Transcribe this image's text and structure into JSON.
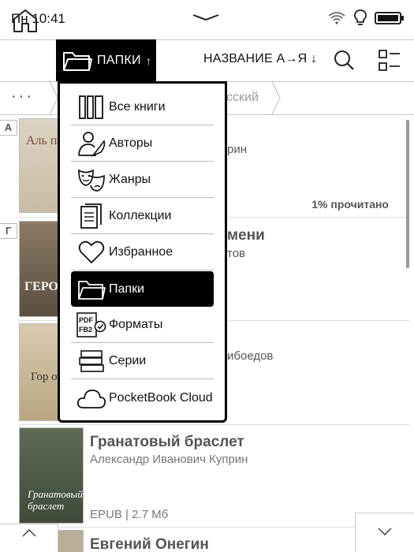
{
  "status_bar": {
    "time": "Пн 10:41"
  },
  "toolbar": {
    "folder_label": "ПАПКИ",
    "folder_arrow": "↑",
    "sort_label": "НАЗВАНИЕ А→Я ↓"
  },
  "breadcrumb": {
    "dots": "···",
    "current": "сский"
  },
  "letters": [
    "А",
    "Г"
  ],
  "books": [
    {
      "partial_title": "",
      "partial_author": "рин",
      "progress": "1% прочитано",
      "cover_text": "Аль пару"
    },
    {
      "partial_title": "мени",
      "partial_author": "тов",
      "cover_text": "ГЕРО"
    },
    {
      "partial_title": "",
      "partial_author": "ибоедов",
      "cover_text": "Гор от у"
    },
    {
      "title": "Гранатовый браслет",
      "author": "Александр Иванович Куприн",
      "meta": "EPUB | 2.7 Мб",
      "cover_text": "Гранатовый браслет"
    },
    {
      "title": "Евгений Онегин"
    }
  ],
  "menu": {
    "items": [
      {
        "label": "Все книги",
        "icon": "books-icon"
      },
      {
        "label": "Авторы",
        "icon": "author-icon"
      },
      {
        "label": "Жанры",
        "icon": "masks-icon"
      },
      {
        "label": "Коллекции",
        "icon": "collection-icon"
      },
      {
        "label": "Избранное",
        "icon": "heart-icon"
      },
      {
        "label": "Папки",
        "icon": "folder-icon",
        "active": true
      },
      {
        "label": "Форматы",
        "icon": "formats-icon",
        "icon_text_top": "PDF",
        "icon_text_bottom": "FB2"
      },
      {
        "label": "Серии",
        "icon": "series-icon"
      },
      {
        "label": "PocketBook Cloud",
        "icon": "cloud-icon"
      }
    ]
  },
  "colors": {
    "accent": "#000000",
    "text": "#222222",
    "muted": "#777777"
  }
}
